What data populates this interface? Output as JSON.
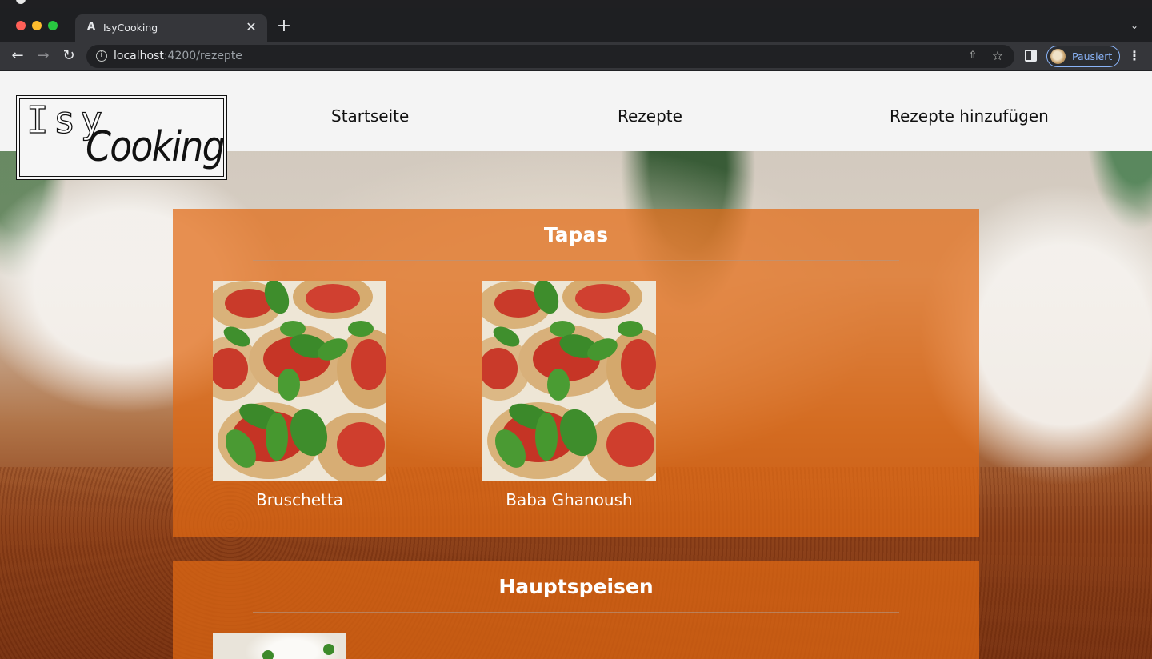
{
  "browser": {
    "tab_title": "IsyCooking",
    "tab_favicon": "A",
    "url_host": "localhost",
    "url_rest": ":4200/rezepte",
    "profile_label": "Pausiert",
    "icons": {
      "back": "arrow-left-icon",
      "forward": "arrow-right-icon",
      "reload": "reload-icon",
      "info": "info-icon",
      "share": "share-icon",
      "bookmark": "star-icon",
      "side_panel": "side-panel-icon",
      "menu": "kebab-menu-icon",
      "close_tab": "close-icon",
      "new_tab": "plus-icon",
      "tab_list": "chevron-down-icon"
    }
  },
  "site": {
    "logo_top": "Isy",
    "logo_bottom": "Cooking",
    "nav": {
      "home": "Startseite",
      "recipes": "Rezepte",
      "add_recipe": "Rezepte hinzufügen"
    }
  },
  "categories": [
    {
      "title": "Tapas",
      "recipes": [
        {
          "name": "Bruschetta",
          "image": "bruschetta"
        },
        {
          "name": "Baba Ghanoush",
          "image": "bruschetta"
        }
      ]
    },
    {
      "title": "Hauptspeisen",
      "recipes": [
        {
          "name": "",
          "image": "rice-dish"
        }
      ]
    }
  ],
  "colors": {
    "panel": "#e26a14",
    "header_bg": "#f4f4f4",
    "chrome_dark": "#35363a",
    "profile_accent": "#8ab4f8"
  }
}
